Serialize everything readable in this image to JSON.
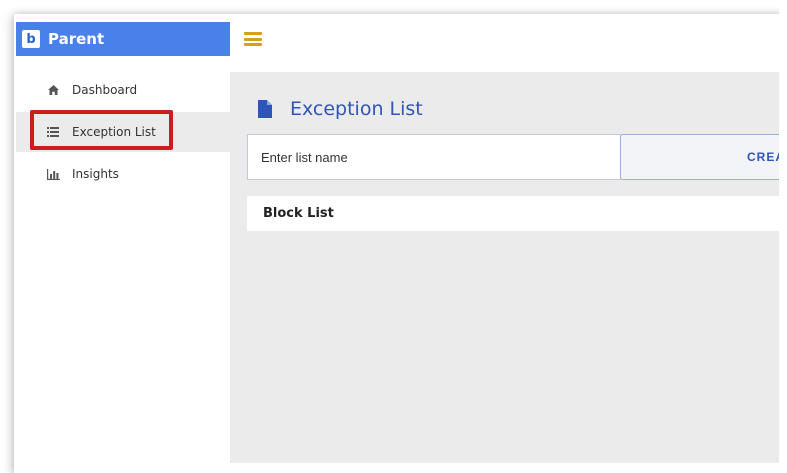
{
  "brand": {
    "logo_letter": "b",
    "title": "Parent",
    "color": "#4a80ea"
  },
  "topbar": {
    "menu_icon": "hamburger-icon",
    "menu_icon_color": "#d4a017"
  },
  "sidebar": {
    "items": [
      {
        "label": "Dashboard",
        "icon": "home-icon",
        "active": false
      },
      {
        "label": "Exception List",
        "icon": "list-icon",
        "active": true
      },
      {
        "label": "Insights",
        "icon": "bar-chart-icon",
        "active": false
      }
    ],
    "highlight_color": "#cc1c1c"
  },
  "main": {
    "page_title": "Exception List",
    "page_icon": "document-icon",
    "list_name_input": {
      "placeholder": "Enter list name",
      "value": ""
    },
    "create_button_label": "CREA",
    "block_list_label": "Block List"
  },
  "colors": {
    "accent": "#2f55b8",
    "content_bg": "#ebebeb"
  }
}
